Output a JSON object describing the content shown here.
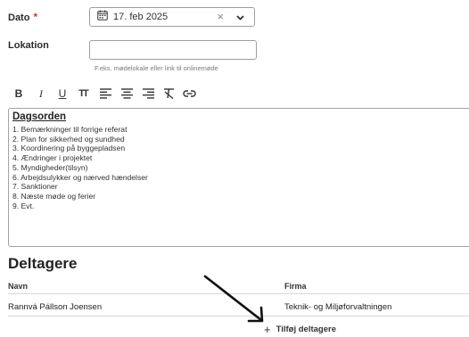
{
  "form": {
    "date_label": "Dato",
    "required_mark": "*",
    "date_value": "17. feb 2025",
    "clear_glyph": "×",
    "location_label": "Lokation",
    "location_value": "",
    "location_hint": "F.eks. mødelokale eller link til onlinemøde"
  },
  "toolbar": {
    "buttons": [
      {
        "label": "B",
        "icon": "bold-icon"
      },
      {
        "label": "I",
        "icon": "italic-icon"
      },
      {
        "label": "U",
        "icon": "underline-icon"
      },
      {
        "label": "TT",
        "icon": "text-size-icon"
      },
      {
        "label": "",
        "icon": "align-left-icon"
      },
      {
        "label": "",
        "icon": "align-center-icon"
      },
      {
        "label": "",
        "icon": "align-right-icon"
      },
      {
        "label": "",
        "icon": "clear-format-icon"
      },
      {
        "label": "",
        "icon": "link-icon"
      }
    ]
  },
  "editor": {
    "title": "Dagsorden",
    "items": [
      "1. Bemærkninger til forrige referat",
      "2. Plan for sikkerhed og sundhed",
      "3. Koordinering på byggepladsen",
      "4. Ændringer i projektet",
      "5. Myndigheder(tilsyn)",
      "6. Arbejdsulykker og nærved hændelser",
      "7. Sanktioner",
      "8. Næste møde og ferier",
      "9. Evt."
    ]
  },
  "participants": {
    "title": "Deltagere",
    "columns": [
      "Navn",
      "Firma"
    ],
    "rows": [
      {
        "name": "Rannvá Pállson Joensen",
        "company": "Teknik- og Miljøforvaltningen"
      }
    ],
    "add_label": "Tilføj deltagere",
    "add_glyph": "+"
  }
}
